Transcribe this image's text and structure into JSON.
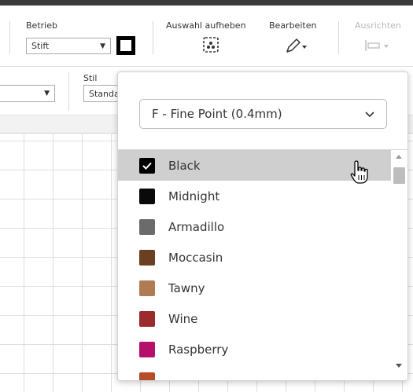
{
  "toolbar": {
    "betrieb_label": "Betrieb",
    "betrieb_value": "Stift",
    "pen_color": "#000000",
    "auswahl_label": "Auswahl aufheben",
    "bearbeiten_label": "Bearbeiten",
    "ausrichten_label": "Ausrichten"
  },
  "toolbar2": {
    "stil_label": "Stil",
    "stil_value": "Standard"
  },
  "dropdown": {
    "pen_tip": "F - Fine Point (0.4mm)",
    "colors": [
      {
        "name": "Black",
        "color": "#000000",
        "selected": true
      },
      {
        "name": "Midnight",
        "color": "#0a0a0a",
        "selected": false
      },
      {
        "name": "Armadillo",
        "color": "#6b6b6b",
        "selected": false
      },
      {
        "name": "Moccasin",
        "color": "#6a3f22",
        "selected": false
      },
      {
        "name": "Tawny",
        "color": "#b07a55",
        "selected": false
      },
      {
        "name": "Wine",
        "color": "#9b2b2c",
        "selected": false
      },
      {
        "name": "Raspberry",
        "color": "#b5116a",
        "selected": false
      },
      {
        "name": "",
        "color": "#b84d2a",
        "selected": false
      }
    ]
  }
}
